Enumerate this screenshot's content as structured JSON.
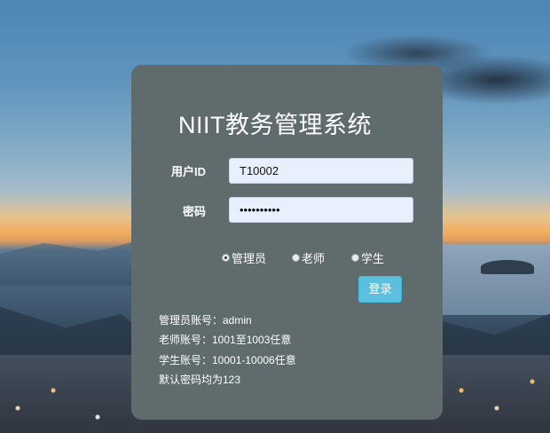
{
  "title": "NIIT教务管理系统",
  "form": {
    "userid_label": "用户ID",
    "userid_value": "T10002",
    "password_label": "密码",
    "password_value": "••••••••••"
  },
  "roles": [
    {
      "label": "管理员",
      "checked": true
    },
    {
      "label": "老师",
      "checked": false
    },
    {
      "label": "学生",
      "checked": false
    }
  ],
  "login_label": "登录",
  "info_lines": [
    "管理员账号：admin",
    "老师账号：1001至1003任意",
    "学生账号：10001-10006任意",
    "默认密码均为123"
  ]
}
